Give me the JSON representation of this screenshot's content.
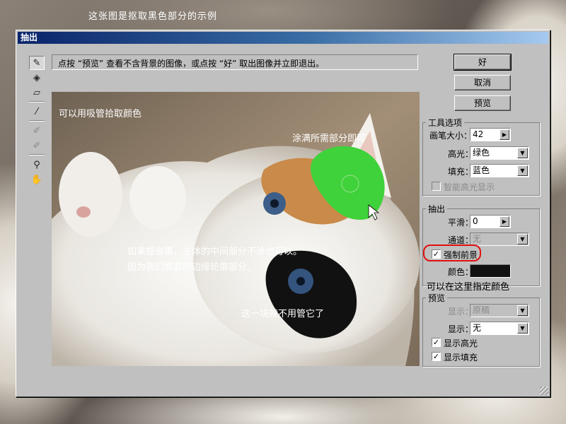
{
  "caption": "这张图是抠取黑色部分的示例",
  "dialog": {
    "title": "抽出",
    "instruction": "点按 “预览” 查看不含背景的图像，或点按 “好” 取出图像并立即退出。"
  },
  "tools": [
    {
      "icon": "edge-highlighter-icon",
      "glyph": "✎",
      "active": true
    },
    {
      "icon": "fill-bucket-icon",
      "glyph": "◈"
    },
    {
      "icon": "eraser-icon",
      "glyph": "▱"
    },
    {
      "icon": "eyedropper-icon",
      "glyph": "⁄"
    },
    {
      "icon": "cleanup-tool-icon",
      "glyph": "✐",
      "dim": true
    },
    {
      "icon": "edge-touchup-icon",
      "glyph": "✐",
      "dim": true
    },
    {
      "icon": "zoom-icon",
      "glyph": "⚲"
    },
    {
      "icon": "hand-icon",
      "glyph": "✋"
    }
  ],
  "buttons": {
    "ok": "好",
    "cancel": "取消",
    "preview": "预览"
  },
  "tool_options": {
    "title": "工具选项",
    "brush_size_label": "画笔大小：",
    "brush_size": "42",
    "highlight_label": "高光：",
    "highlight": "绿色",
    "fill_label": "填充：",
    "fill": "蓝色",
    "smart_highlight": "智能高光显示"
  },
  "extract": {
    "title": "抽出",
    "smooth_label": "平滑：",
    "smooth": "0",
    "channel_label": "通道：",
    "channel": "无",
    "force_foreground": "强制前景",
    "force_foreground_checked": true,
    "color_label": "颜色：",
    "color": "#111111"
  },
  "preview_group": {
    "title": "预览",
    "show_label": "显示：",
    "show": "原稿",
    "display_label": "显示：",
    "display": "无",
    "show_highlight": "显示高光",
    "show_fill": "显示填充"
  },
  "annotations": {
    "eyedropper": "可以用吸管拾取颜色",
    "fill_area": "涂满所需部分即可",
    "lazy_1": "如果想省事，主体的中间部分不涂也可以。",
    "lazy_2": "因为我们需要的边缘轮廓部分。",
    "no_need": "这一块就不用管它了",
    "set_color": "可以在这里指定颜色"
  },
  "colors": {
    "highlight_green": "#3fd23a",
    "annotation_red": "#e01010",
    "title_blue": "#0a246a"
  }
}
